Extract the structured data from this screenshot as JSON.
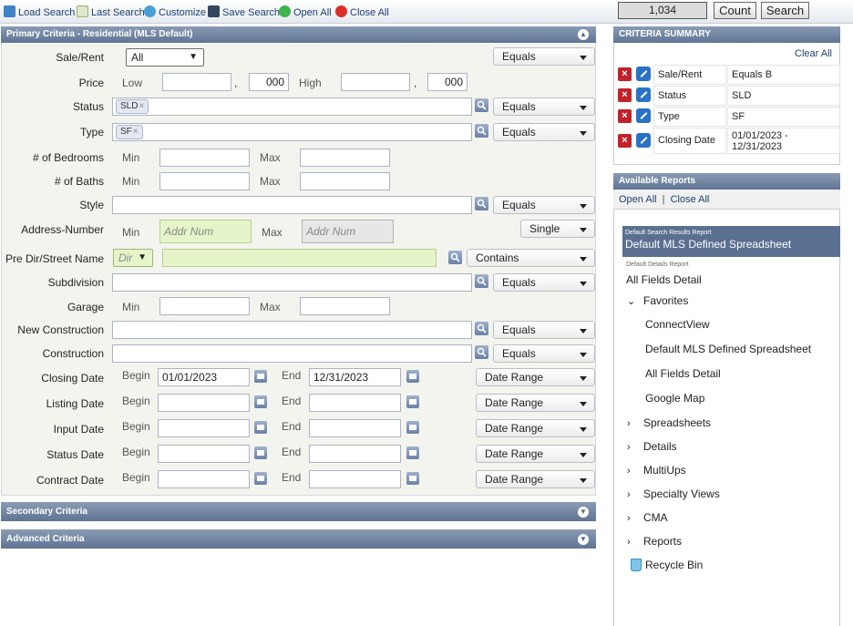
{
  "toolbar": {
    "load_search": "Load Search",
    "last_search": "Last Search",
    "customize": "Customize",
    "save_search": "Save Search",
    "open_all": "Open All",
    "close_all": "Close All",
    "count_value": "1,034",
    "count_button": "Count",
    "search_button": "Search"
  },
  "primary": {
    "title": "Primary Criteria - Residential (MLS Default)",
    "sale_rent": {
      "label": "Sale/Rent",
      "value": "All",
      "operator": "Equals"
    },
    "price": {
      "label": "Price",
      "low_label": "Low",
      "high_label": "High",
      "low_cents": "000",
      "high_cents": "000",
      "comma": ","
    },
    "status": {
      "label": "Status",
      "tag": "SLD",
      "operator": "Equals"
    },
    "type": {
      "label": "Type",
      "tag": "SF",
      "operator": "Equals"
    },
    "bedrooms": {
      "label": "# of Bedrooms",
      "min": "Min",
      "max": "Max"
    },
    "baths": {
      "label": "# of Baths",
      "min": "Min",
      "max": "Max"
    },
    "style": {
      "label": "Style",
      "operator": "Equals"
    },
    "address": {
      "label": "Address-Number",
      "min": "Min",
      "max": "Max",
      "placeholder": "Addr Num",
      "operator": "Single"
    },
    "street": {
      "label": "Pre Dir/Street Name",
      "dir": "Dir",
      "operator": "Contains"
    },
    "subdivision": {
      "label": "Subdivision",
      "operator": "Equals"
    },
    "garage": {
      "label": "Garage",
      "min": "Min",
      "max": "Max"
    },
    "new_construction": {
      "label": "New Construction",
      "operator": "Equals"
    },
    "construction": {
      "label": "Construction",
      "operator": "Equals"
    },
    "begin": "Begin",
    "end": "End",
    "closing_date": {
      "label": "Closing Date",
      "begin_value": "01/01/2023",
      "end_value": "12/31/2023",
      "operator": "Date Range"
    },
    "listing_date": {
      "label": "Listing Date",
      "operator": "Date Range"
    },
    "input_date": {
      "label": "Input Date",
      "operator": "Date Range"
    },
    "status_date": {
      "label": "Status Date",
      "operator": "Date Range"
    },
    "contract_date": {
      "label": "Contract Date",
      "operator": "Date Range"
    }
  },
  "secondary": {
    "title": "Secondary Criteria"
  },
  "advanced": {
    "title": "Advanced Criteria"
  },
  "summary": {
    "title": "CRITERIA SUMMARY",
    "clear_all": "Clear All",
    "rows": [
      {
        "field": "Sale/Rent",
        "value": "Equals B"
      },
      {
        "field": "Status",
        "value": "SLD"
      },
      {
        "field": "Type",
        "value": "SF"
      },
      {
        "field": "Closing Date",
        "value_line1": "01/01/2023 -",
        "value_line2": "12/31/2023"
      }
    ]
  },
  "reports": {
    "title": "Available Reports",
    "open_all": "Open All",
    "separator": "|",
    "close_all": "Close All",
    "default_search_caption": "Default Search Results Report",
    "default_search_name": "Default MLS Defined Spreadsheet",
    "default_details_caption": "Default Details Report",
    "default_details_name": "All Fields Detail",
    "favorites": "Favorites",
    "favorite_items": [
      "ConnectView",
      "Default MLS Defined Spreadsheet",
      "All Fields Detail",
      "Google Map"
    ],
    "groups": [
      "Spreadsheets",
      "Details",
      "MultiUps",
      "Specialty Views",
      "CMA",
      "Reports"
    ],
    "recycle_bin": "Recycle Bin"
  }
}
